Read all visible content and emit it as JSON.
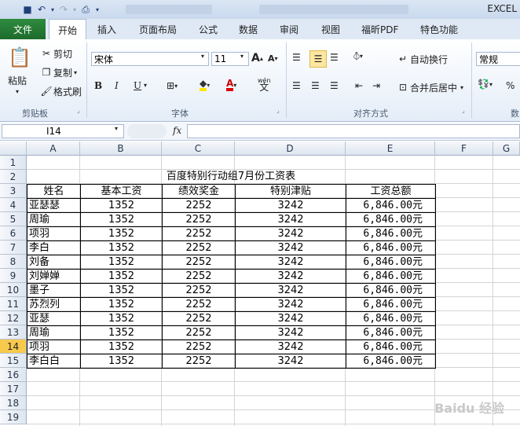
{
  "window": {
    "title": "EXCEL"
  },
  "ribbon_tabs": [
    "文件",
    "开始",
    "插入",
    "页面布局",
    "公式",
    "数据",
    "审阅",
    "视图",
    "福昕PDF",
    "特色功能"
  ],
  "clipboard": {
    "paste": "粘贴",
    "cut": "剪切",
    "copy": "复制",
    "format_painter": "格式刷",
    "group": "剪贴板"
  },
  "font": {
    "name": "宋体",
    "size": "11",
    "group": "字体",
    "bold": "B",
    "italic": "I",
    "underline": "U"
  },
  "alignment": {
    "wrap": "自动换行",
    "merge": "合并后居中",
    "group": "对齐方式"
  },
  "number": {
    "format": "常规",
    "group": "数"
  },
  "formula_bar": {
    "name_box": "I14",
    "fx": "fx"
  },
  "columns": [
    "A",
    "B",
    "C",
    "D",
    "E",
    "F",
    "G"
  ],
  "rows": [
    "1",
    "2",
    "3",
    "4",
    "5",
    "6",
    "7",
    "8",
    "9",
    "10",
    "11",
    "12",
    "13",
    "14",
    "15",
    "16",
    "17",
    "18",
    "19"
  ],
  "selected_row": "14",
  "sheet": {
    "title": "百度特别行动组7月份工资表",
    "headers": [
      "姓名",
      "基本工资",
      "绩效奖金",
      "特别津贴",
      "工资总额"
    ],
    "data": [
      [
        "亚瑟瑟",
        "1352",
        "2252",
        "3242",
        "6,846.00元"
      ],
      [
        "周瑜",
        "1352",
        "2252",
        "3242",
        "6,846.00元"
      ],
      [
        "项羽",
        "1352",
        "2252",
        "3242",
        "6,846.00元"
      ],
      [
        "李白",
        "1352",
        "2252",
        "3242",
        "6,846.00元"
      ],
      [
        "刘备",
        "1352",
        "2252",
        "3242",
        "6,846.00元"
      ],
      [
        "刘婵婵",
        "1352",
        "2252",
        "3242",
        "6,846.00元"
      ],
      [
        "墨子",
        "1352",
        "2252",
        "3242",
        "6,846.00元"
      ],
      [
        "苏烈列",
        "1352",
        "2252",
        "3242",
        "6,846.00元"
      ],
      [
        "亚瑟",
        "1352",
        "2252",
        "3242",
        "6,846.00元"
      ],
      [
        "周瑜",
        "1352",
        "2252",
        "3242",
        "6,846.00元"
      ],
      [
        "项羽",
        "1352",
        "2252",
        "3242",
        "6,846.00元"
      ],
      [
        "李白白",
        "1352",
        "2252",
        "3242",
        "6,846.00元"
      ]
    ]
  },
  "watermark": "Baidu 经验"
}
